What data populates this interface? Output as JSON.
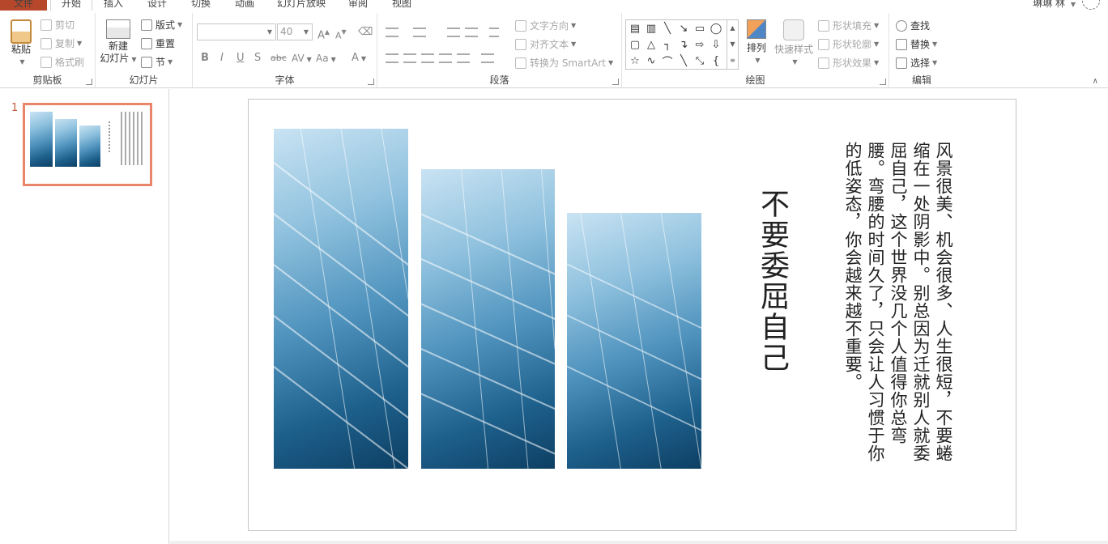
{
  "tabs": {
    "file": "文件",
    "home": "开始",
    "insert": "插入",
    "design": "设计",
    "transitions": "切换",
    "animations": "动画",
    "slideshow": "幻灯片放映",
    "review": "审阅",
    "view": "视图"
  },
  "user": {
    "name": "琳琳 林"
  },
  "clipboard": {
    "paste": "粘贴",
    "cut": "剪切",
    "copy": "复制",
    "format_painter": "格式刷",
    "label": "剪贴板"
  },
  "slides_group": {
    "new_slide_line1": "新建",
    "new_slide_line2": "幻灯片",
    "layout": "版式",
    "reset": "重置",
    "section": "节",
    "label": "幻灯片"
  },
  "font": {
    "size": "40",
    "label": "字体",
    "bold": "B",
    "italic": "I",
    "underline": "U",
    "shadow": "S",
    "strike": "abc",
    "spacing": "AV",
    "case": "Aa",
    "color": "A",
    "grow": "A",
    "shrink": "A"
  },
  "paragraph": {
    "text_direction": "文字方向",
    "align_text": "对齐文本",
    "smartart": "转换为 SmartArt",
    "label": "段落"
  },
  "drawing": {
    "arrange": "排列",
    "quick_styles": "快速样式",
    "shape_fill": "形状填充",
    "shape_outline": "形状轮廓",
    "shape_effects": "形状效果",
    "label": "绘图"
  },
  "editing": {
    "find": "查找",
    "replace": "替换",
    "select": "选择",
    "label": "编辑"
  },
  "thumbnail": {
    "number": "1"
  },
  "slide": {
    "title": "不要委屈自己",
    "body": "风景很美、机会很多、人生很短，不要蜷缩在一处阴影中。别总因为迁就别人就委屈自己，这个世界没几个人值得你总弯腰。弯腰的时间久了，只会让人习惯于你的低姿态，你会越来越不重要。"
  },
  "colors": {
    "accent": "#b7472a",
    "thumb_border": "#e8856a"
  }
}
